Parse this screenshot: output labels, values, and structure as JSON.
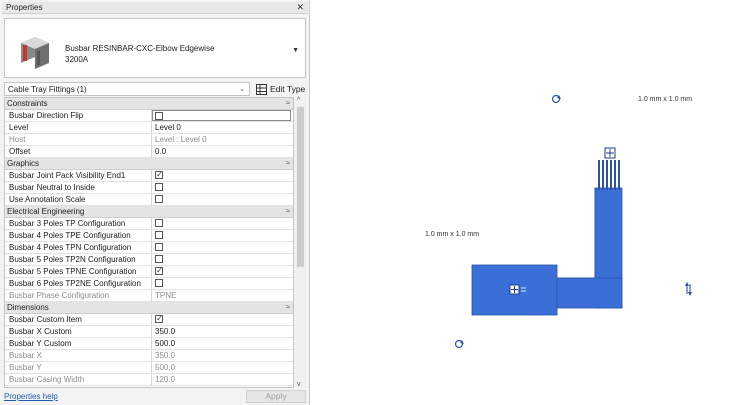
{
  "panel": {
    "title": "Properties",
    "close_glyph": "✕",
    "type": {
      "name_line1": "Busbar RESINBAR-CXC-Elbow Edgewise",
      "name_line2": "3200A"
    },
    "selector": {
      "value": "Cable Tray Fittings (1)",
      "edit_type_label": "Edit Type"
    },
    "categories": [
      {
        "label": "Constraints",
        "rows": [
          {
            "label": "Busbar Direction Flip",
            "kind": "checkbox",
            "checked": false,
            "active": true
          },
          {
            "label": "Level",
            "kind": "text",
            "value": "Level 0"
          },
          {
            "label": "Host",
            "kind": "text",
            "value": "Level : Level 0",
            "readonly": true
          },
          {
            "label": "Offset",
            "kind": "text",
            "value": "0.0"
          }
        ]
      },
      {
        "label": "Graphics",
        "rows": [
          {
            "label": "Busbar Joint Pack Visibility End1",
            "kind": "checkbox",
            "checked": true
          },
          {
            "label": "Busbar Neutral to Inside",
            "kind": "checkbox",
            "checked": false
          },
          {
            "label": "Use Annotation Scale",
            "kind": "checkbox",
            "checked": false
          }
        ]
      },
      {
        "label": "Electrical Engineering",
        "rows": [
          {
            "label": "Busbar 3 Poles TP Configuration",
            "kind": "checkbox",
            "checked": false
          },
          {
            "label": "Busbar 4 Poles TPE Configuration",
            "kind": "checkbox",
            "checked": false
          },
          {
            "label": "Busbar 4 Poles TPN Configuration",
            "kind": "checkbox",
            "checked": false
          },
          {
            "label": "Busbar 5 Poles TP2N Configuration",
            "kind": "checkbox",
            "checked": false
          },
          {
            "label": "Busbar 5 Poles TPNE Configuration",
            "kind": "checkbox",
            "checked": true
          },
          {
            "label": "Busbar 6 Poles TP2NE Configuration",
            "kind": "checkbox",
            "checked": false
          },
          {
            "label": "Busbar Phase Configuration",
            "kind": "text",
            "value": "TPNE",
            "readonly": true
          }
        ]
      },
      {
        "label": "Dimensions",
        "rows": [
          {
            "label": "Busbar Custom Item",
            "kind": "checkbox",
            "checked": true
          },
          {
            "label": "Busbar X Custom",
            "kind": "text",
            "value": "350.0"
          },
          {
            "label": "Busbar Y Custom",
            "kind": "text",
            "value": "500.0"
          },
          {
            "label": "Busbar X",
            "kind": "text",
            "value": "350.0",
            "readonly": true
          },
          {
            "label": "Busbar Y",
            "kind": "text",
            "value": "500.0",
            "readonly": true
          },
          {
            "label": "Busbar Casing Width",
            "kind": "text",
            "value": "120.0",
            "readonly": true
          }
        ]
      }
    ],
    "footer": {
      "help_link": "Properties help",
      "apply_label": "Apply"
    }
  },
  "canvas": {
    "dim_label_top": "1.0 mm x 1.0 mm",
    "dim_label_left": "1.0 mm x 1.0 mm",
    "busbar_color": "#3a6fd8",
    "busbar_dark": "#2a52a8"
  }
}
